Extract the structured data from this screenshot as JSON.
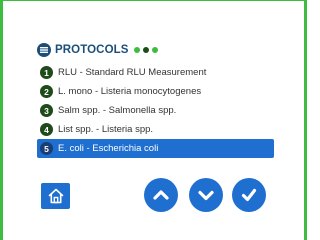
{
  "header": {
    "title": "PROTOCOLS",
    "icon": "list-icon",
    "dots": [
      "#3dbd3f",
      "#1f4a1a",
      "#3dbd3f"
    ]
  },
  "protocols": [
    {
      "num": "1",
      "label": "RLU - Standard RLU Measurement",
      "selected": false
    },
    {
      "num": "2",
      "label": "L. mono - Listeria monocytogenes",
      "selected": false
    },
    {
      "num": "3",
      "label": "Salm spp. - Salmonella spp.",
      "selected": false
    },
    {
      "num": "4",
      "label": "List spp. - Listeria spp.",
      "selected": false
    },
    {
      "num": "5",
      "label": "E. coli - Escherichia coli",
      "selected": true
    }
  ],
  "buttons": {
    "home": "home-icon",
    "up": "chevron-up-icon",
    "down": "chevron-down-icon",
    "confirm": "checkmark-icon"
  },
  "colors": {
    "accent": "#1f6fd0",
    "frame": "#3dbd3f",
    "badge": "#1f4a1a",
    "title": "#1b4f7a"
  }
}
